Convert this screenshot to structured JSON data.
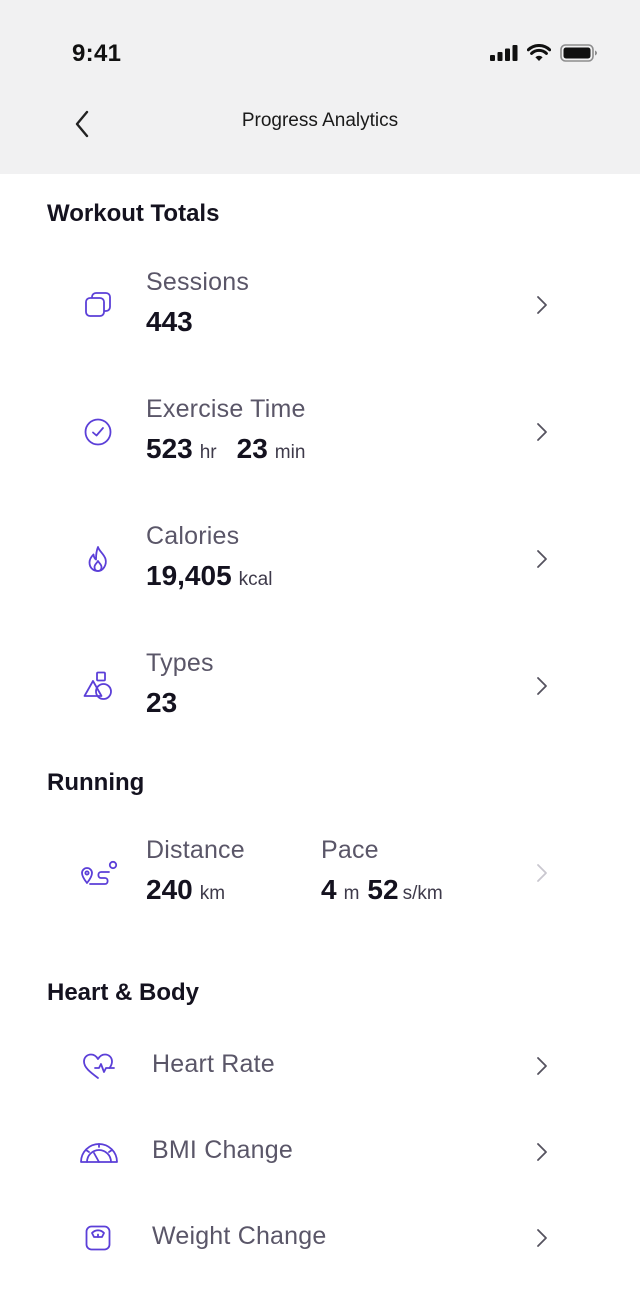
{
  "status_bar": {
    "time": "9:41"
  },
  "nav": {
    "title": "Progress Analytics"
  },
  "sections": {
    "workout": {
      "title": "Workout Totals"
    },
    "running": {
      "title": "Running"
    },
    "heart": {
      "title": "Heart & Body"
    }
  },
  "workout_totals": {
    "sessions": {
      "label": "Sessions",
      "value": "443"
    },
    "exercise_time": {
      "label": "Exercise Time",
      "hours": "523",
      "hours_unit": "hr",
      "minutes": "23",
      "minutes_unit": "min"
    },
    "calories": {
      "label": "Calories",
      "value": "19,405",
      "unit": "kcal"
    },
    "types": {
      "label": "Types",
      "value": "23"
    }
  },
  "running": {
    "distance": {
      "label": "Distance",
      "value": "240",
      "unit": "km"
    },
    "pace": {
      "label": "Pace",
      "minutes": "4",
      "minutes_unit": "m",
      "seconds": "52",
      "seconds_unit": "s/km"
    }
  },
  "heart_body": {
    "heart_rate": {
      "label": "Heart Rate"
    },
    "bmi_change": {
      "label": "BMI Change"
    },
    "weight_change": {
      "label": "Weight Change"
    }
  },
  "colors": {
    "accent": "#5b3fd8",
    "header_bg": "#f1f1f2",
    "text": "#14121f",
    "muted": "#5a5668"
  },
  "icons": {
    "back": "chevron-left-icon",
    "sessions": "stacked-squares-icon",
    "exercise_time": "clock-icon",
    "calories": "flame-icon",
    "types": "shapes-icon",
    "running": "route-icon",
    "heart_rate": "heart-pulse-icon",
    "bmi": "gauge-icon",
    "weight": "scale-icon"
  }
}
